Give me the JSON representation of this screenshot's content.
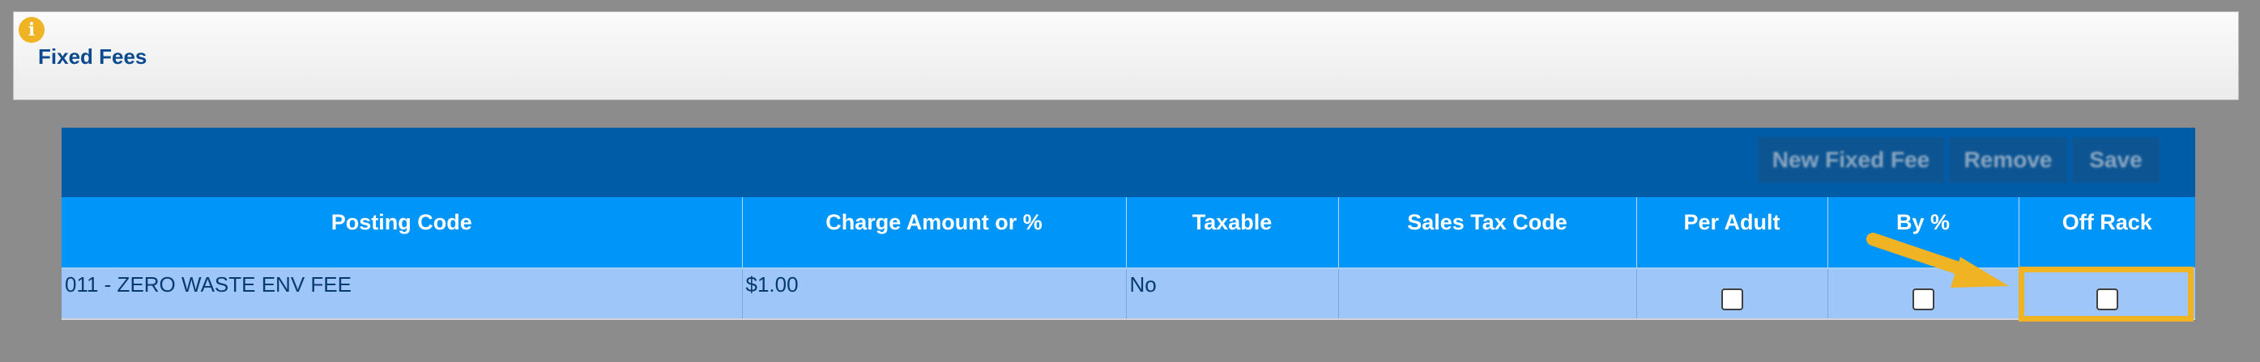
{
  "header": {
    "title": "Fixed Fees",
    "info_icon": "info-icon",
    "info_icon_color": "#f0b323",
    "info_glyph": "i"
  },
  "toolbar": {
    "buttons": [
      {
        "label": "New Fixed Fee"
      },
      {
        "label": "Remove"
      },
      {
        "label": "Save"
      }
    ]
  },
  "table": {
    "columns": [
      "Posting Code",
      "Charge Amount or %",
      "Taxable",
      "Sales Tax Code",
      "Per Adult",
      "By %",
      "Off Rack"
    ],
    "rows": [
      {
        "posting_code": "011 - ZERO WASTE ENV FEE",
        "charge_amount": "$1.00",
        "taxable": "No",
        "sales_tax_code": "",
        "per_adult": false,
        "by_percent": false,
        "off_rack": false
      }
    ]
  },
  "annotation": {
    "color": "#f0b323",
    "target": "off-rack-checkbox"
  },
  "colors": {
    "toolbar_bg": "#005ca7",
    "header_row_bg": "#0095f8",
    "data_row_bg": "#9fc6f8",
    "title_color": "#0b4a8f"
  }
}
